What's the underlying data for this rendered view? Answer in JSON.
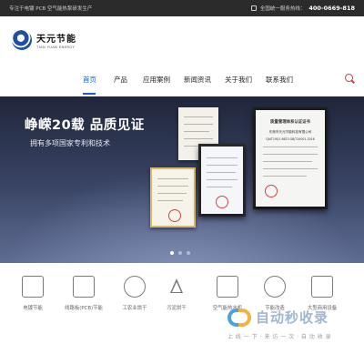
{
  "topbar": {
    "slogan": "专注于电镀 PCB 空气能热泵研发生产",
    "hotline_label": "全国统一服务热线：",
    "phone": "400-0669-818"
  },
  "brand": {
    "name_cn": "天元节能",
    "name_en": "TIAN YUAN ENERGY"
  },
  "nav": {
    "items": [
      {
        "label": "首页",
        "active": true
      },
      {
        "label": "产品",
        "active": false
      },
      {
        "label": "应用案例",
        "active": false
      },
      {
        "label": "新闻资讯",
        "active": false
      },
      {
        "label": "关于我们",
        "active": false
      },
      {
        "label": "联系我们",
        "active": false
      }
    ],
    "accent_color": "#1f5cc4"
  },
  "banner": {
    "headline": "峥嵘20载  品质见证",
    "subline": "拥有多项国家专利和技术",
    "slide_count": 3,
    "active_slide": 1,
    "certificates": {
      "main_title": "质量管理体系认证证书",
      "main_company": "东莞市天元节能科技有限公司",
      "main_code": "QAIT19Q1 8623 GB/T19001-2016"
    }
  },
  "categories": [
    {
      "label": "电镀节能",
      "icon": "electroplating-icon"
    },
    {
      "label": "线路板(PCB)节能",
      "icon": "pcb-icon"
    },
    {
      "label": "工农业烘干",
      "icon": "leaf-drying-icon"
    },
    {
      "label": "污泥烘干",
      "icon": "sludge-drying-icon"
    },
    {
      "label": "空气能热水机",
      "icon": "water-heater-icon"
    },
    {
      "label": "节能改造",
      "icon": "renovation-icon"
    },
    {
      "label": "大型商用设备",
      "icon": "commercial-equipment-icon"
    }
  ],
  "watermark": {
    "text": "自动秒收录",
    "subtext": "上 线 一 下 · 来 访 一 次 · 自 动 收 录"
  }
}
